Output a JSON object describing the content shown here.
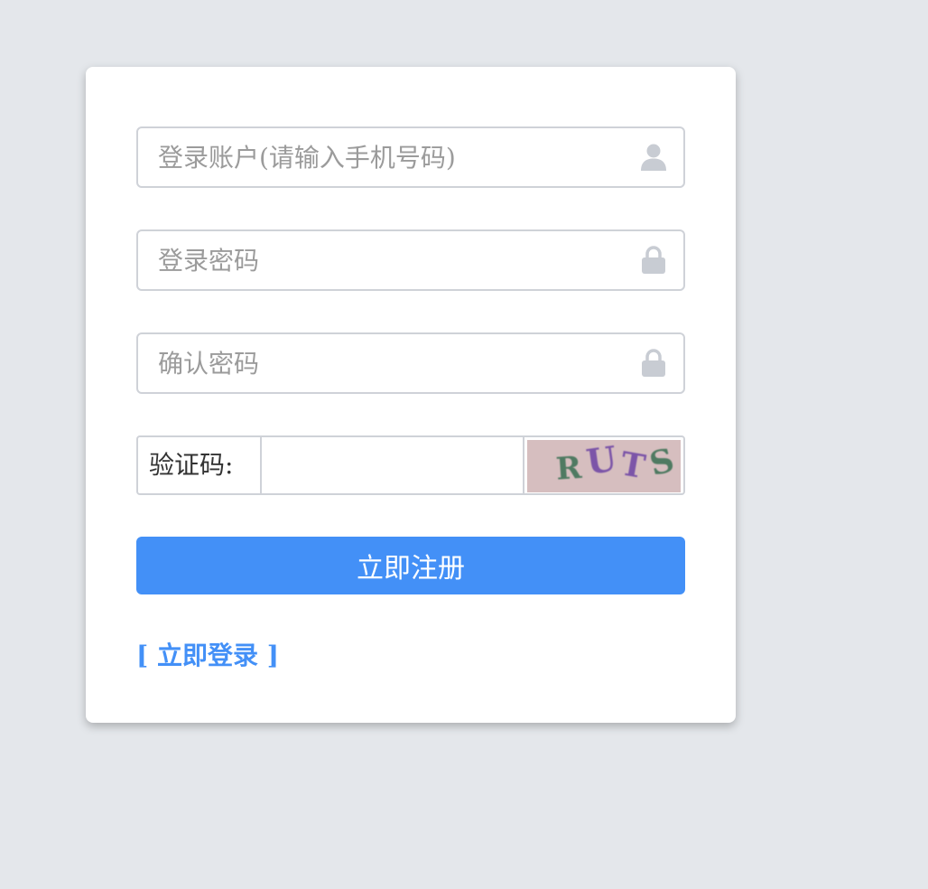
{
  "form": {
    "account": {
      "placeholder": "登录账户(请输入手机号码)",
      "value": "",
      "icon": "user-icon"
    },
    "password": {
      "placeholder": "登录密码",
      "value": "",
      "icon": "lock-icon"
    },
    "confirm_password": {
      "placeholder": "确认密码",
      "value": "",
      "icon": "lock-icon"
    },
    "captcha": {
      "label": "验证码:",
      "value": "",
      "image_text": "RUTS"
    },
    "register_button": "立即注册",
    "login_link": "[ 立即登录 ]"
  },
  "colors": {
    "page_background": "#e4e7eb",
    "card_background": "#ffffff",
    "primary": "#4390f7",
    "border": "#cfd2d8",
    "icon": "#c8ccd3",
    "captcha_background": "#d8c0c2"
  }
}
